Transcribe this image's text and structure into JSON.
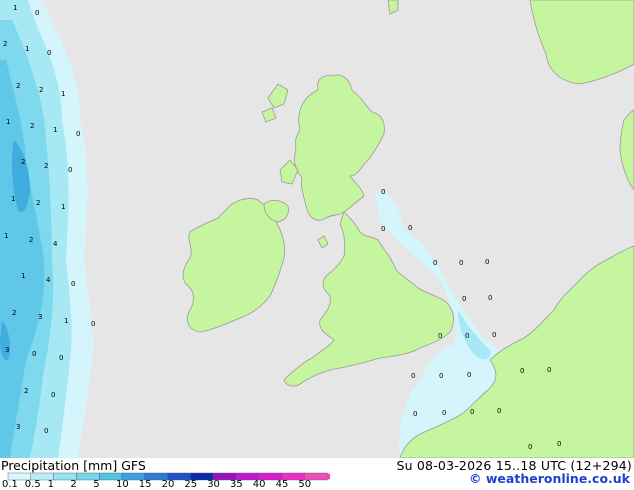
{
  "legend": {
    "title": "Precipitation [mm]",
    "model": "GFS",
    "ticks": [
      "0.1",
      "0.5",
      "1",
      "2",
      "5",
      "10",
      "15",
      "20",
      "25",
      "30",
      "35",
      "40",
      "45",
      "50"
    ],
    "colors": [
      "#d9f7ff",
      "#b7eef8",
      "#96e3f2",
      "#73d4ec",
      "#52c1e6",
      "#3f9fe0",
      "#2f7ad8",
      "#1f52c8",
      "#0b2ba8",
      "#9c10c4",
      "#c018d0",
      "#d91ed0",
      "#e830c8",
      "#f04bb8"
    ]
  },
  "timestamp": "Su 08-03-2026 15..18 UTC (12+294)",
  "credit": "© weatheronline.co.uk",
  "colors": {
    "sea": "#e6e6e6",
    "land": "#c6f5a0",
    "coast": "#9a9a9a",
    "precip_light": "#d4f5fb",
    "precip_mid": "#a6e9f5",
    "precip_strong": "#7fd9ee",
    "precip_heavy": "#5fc8e8"
  },
  "precip_labels": [
    "1",
    "0",
    "2",
    "1",
    "0",
    "2",
    "2",
    "1",
    "1",
    "2",
    "1",
    "0",
    "2",
    "2",
    "0",
    "1",
    "2",
    "1",
    "1",
    "2",
    "4",
    "1",
    "4",
    "0",
    "2",
    "3",
    "1",
    "0",
    "3",
    "0",
    "0",
    "2",
    "0",
    "3",
    "0",
    "0",
    "0",
    "0",
    "0",
    "0",
    "0",
    "0",
    "0",
    "0",
    "0",
    "0",
    "0",
    "0",
    "0",
    "0",
    "0",
    "0",
    "0",
    "0",
    "0",
    "0",
    "0"
  ]
}
